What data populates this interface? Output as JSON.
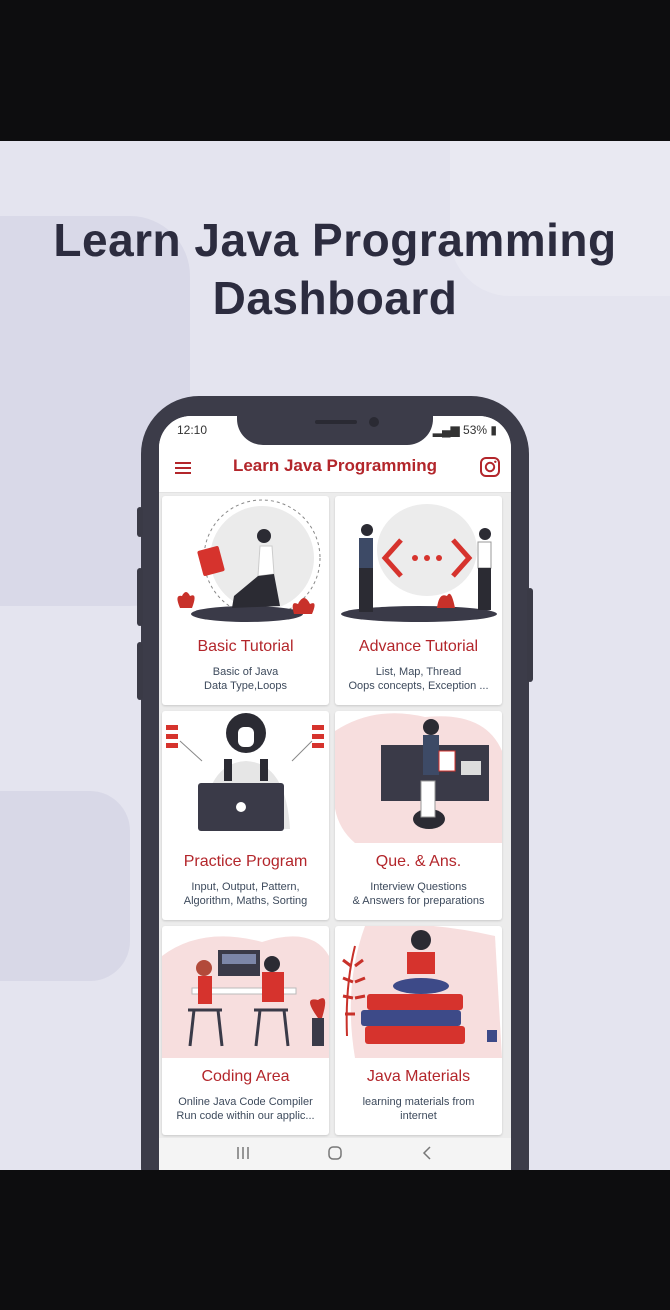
{
  "headline": {
    "line1": "Learn Java Programming",
    "line2": "Dashboard"
  },
  "status_bar": {
    "time": "12:10",
    "battery": "53%"
  },
  "app_bar": {
    "title": "Learn Java Programming",
    "menu_icon": "hamburger-menu-icon",
    "instagram_icon": "instagram-icon"
  },
  "cards": [
    {
      "title": "Basic Tutorial",
      "line1": "Basic of Java",
      "line2": "Data Type,Loops"
    },
    {
      "title": "Advance Tutorial",
      "line1": "List, Map, Thread",
      "line2": "Oops concepts, Exception ..."
    },
    {
      "title": "Practice Program",
      "line1": "Input, Output, Pattern,",
      "line2": "Algorithm, Maths, Sorting"
    },
    {
      "title": "Que. & Ans.",
      "line1": "Interview Questions",
      "line2": "& Answers for preparations"
    },
    {
      "title": "Coding Area",
      "line1": "Online Java Code Compiler",
      "line2": "Run code within our applic..."
    },
    {
      "title": "Java Materials",
      "line1": "learning materials from",
      "line2": "internet"
    }
  ],
  "nav_bar": {
    "recent_icon": "recent-apps-icon",
    "home_icon": "home-icon",
    "back_icon": "back-icon"
  },
  "colors": {
    "accent": "#b3262b",
    "phone_frame": "#3c3c49",
    "background": "#e4e4ef"
  }
}
